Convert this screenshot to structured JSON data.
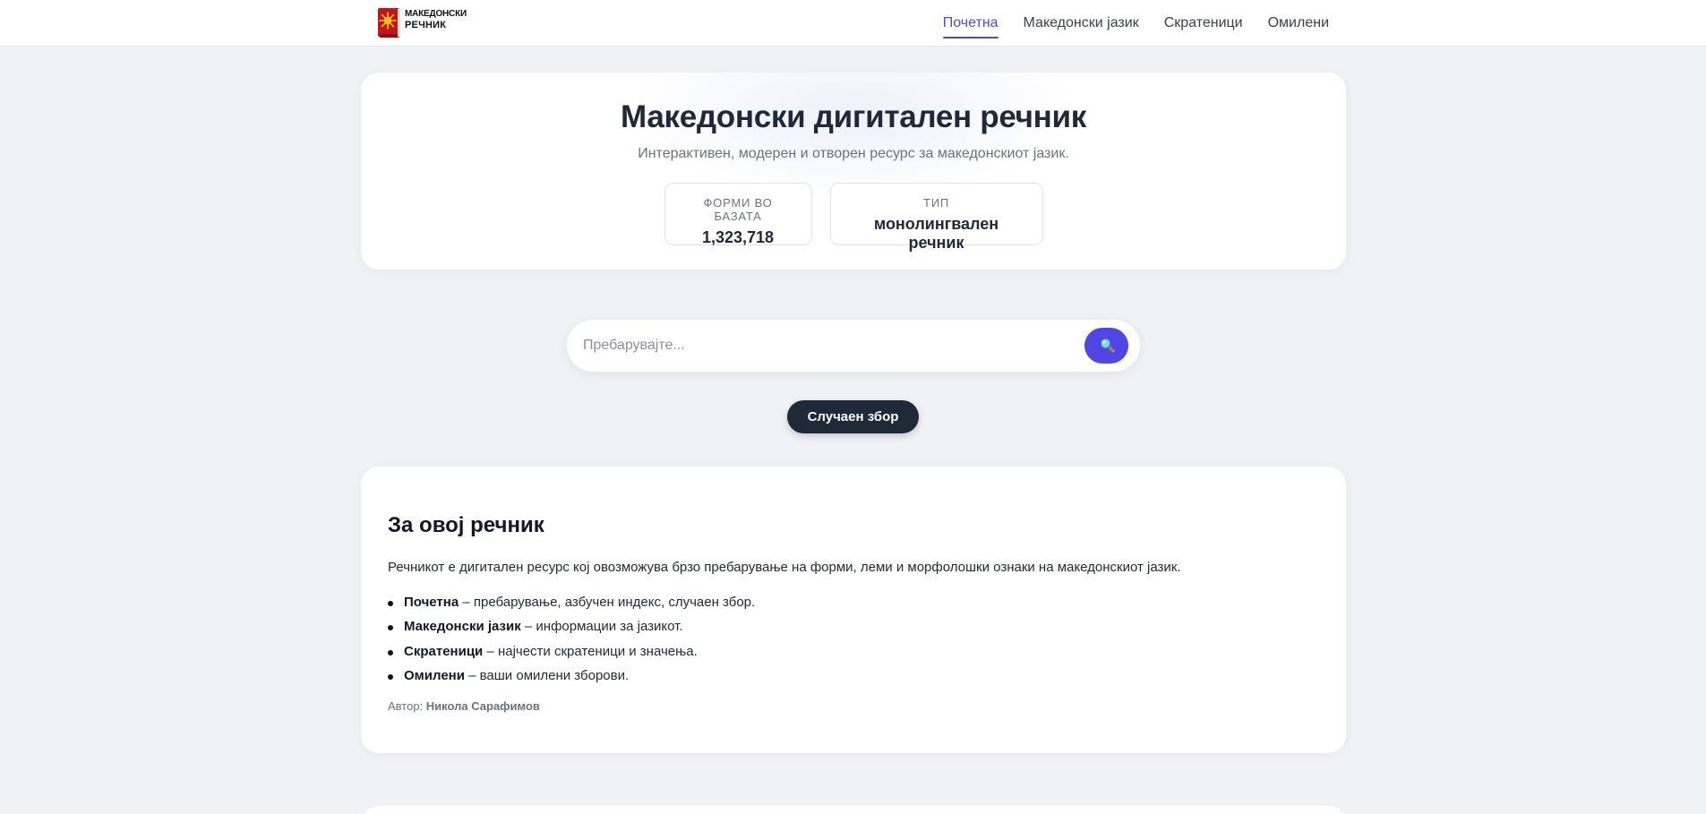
{
  "header": {
    "logo": {
      "line1": "МАКЕДОНСКИ",
      "line2": "РЕЧНИК",
      "icon": "book-icon"
    },
    "nav": [
      {
        "label": "Почетна",
        "active": true
      },
      {
        "label": "Македонски јазик",
        "active": false
      },
      {
        "label": "Скратеници",
        "active": false
      },
      {
        "label": "Омилени",
        "active": false
      }
    ],
    "accent": "#4f46e5"
  },
  "hero": {
    "title": "Македонски дигитален речник",
    "subtitle": "Интерактивен, модерен и отворен ресурс за македонскиот јазик.",
    "stats": [
      {
        "label": "Форми во базата",
        "value": "1,323,718"
      },
      {
        "label": "Тип",
        "value": "монолингвален речник"
      }
    ]
  },
  "search": {
    "placeholder": "Пребарувајте...",
    "value": "",
    "button_icon": "search-icon"
  },
  "random": {
    "label": "Случаен збор"
  },
  "about": {
    "title": "За овој речник",
    "description": "Речникот е дигитален ресурс кој овозможува брзо пребарување на форми, леми и морфолошки ознаки на македонскиот јазик.",
    "items": [
      {
        "term": "Почетна",
        "text": " – пребарување, азбучен индекс, случаен збор."
      },
      {
        "term": "Македонски јазик",
        "text": " – информации за јазикот."
      },
      {
        "term": "Скратеници",
        "text": " – најчести скратеници и значења."
      },
      {
        "term": "Омилени",
        "text": " – ваши омилени зборови."
      }
    ],
    "author_label": "Автор:",
    "author_name": "Никола Сарафимов"
  }
}
